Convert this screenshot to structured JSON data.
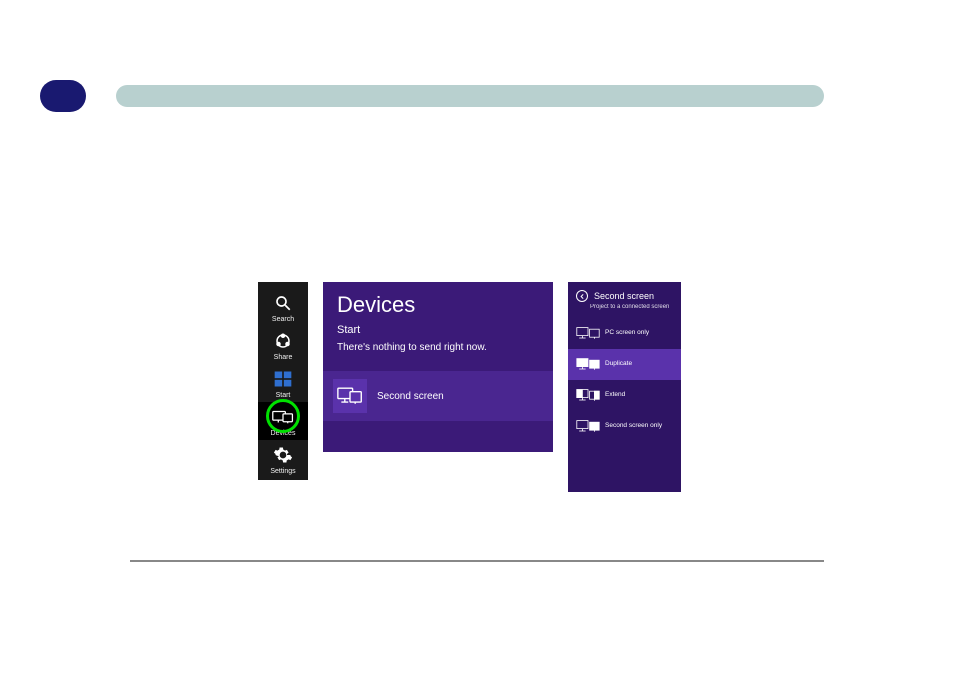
{
  "charms": {
    "search": "Search",
    "share": "Share",
    "start": "Start",
    "devices": "Devices",
    "settings": "Settings"
  },
  "devices_panel": {
    "title": "Devices",
    "subtitle": "Start",
    "message": "There's nothing to send right now.",
    "item_label": "Second screen"
  },
  "second_screen_panel": {
    "title": "Second screen",
    "caption": "Project to a connected screen",
    "options": {
      "pc_only": "PC screen only",
      "duplicate": "Duplicate",
      "extend": "Extend",
      "second_only": "Second screen only"
    }
  }
}
